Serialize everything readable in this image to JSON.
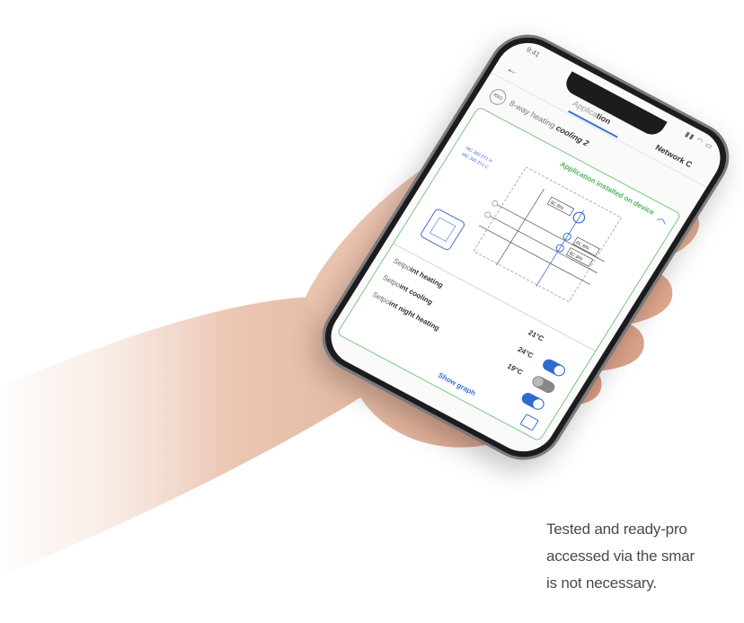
{
  "phone": {
    "status_time": "9:41",
    "status_icons": "▮▮ ◠ ▭",
    "back_icon": "back-arrow-icon",
    "tab_application_prefix": "Applica",
    "tab_application_bold": "tion",
    "tab_network": "Network C",
    "app_logo_text": "REG",
    "app_title_prefix": "8-way heating ",
    "app_title_bold": "cooling 2",
    "install_status": "Application installed on device",
    "diagram_labels": [
      "MC 300 3T1 H",
      "MC 300 3T1 C",
      "8C 8IN",
      "8C 8IN",
      "8C 8IN"
    ],
    "settings": [
      {
        "prefix": "Setpo",
        "label": "int heating",
        "value": "21°C",
        "toggle": "none"
      },
      {
        "prefix": "Setpo",
        "label": "int cooling",
        "value": "24°C",
        "toggle": "on"
      },
      {
        "prefix": "Setpo",
        "label": "int night heating",
        "value": "19°C",
        "toggle": "off"
      }
    ],
    "fourth_toggle": "on",
    "show_graph": "Show graph",
    "graph_icon": "chart-icon"
  },
  "caption": {
    "line1": "Tested and ready-pro",
    "line2": "accessed via the smar",
    "line3": "is not necessary."
  },
  "colors": {
    "accent": "#3b6fd6",
    "installed_green": "#55b25b",
    "panel_border": "#7bc67e",
    "phone_frame": "#1c1c1e"
  }
}
